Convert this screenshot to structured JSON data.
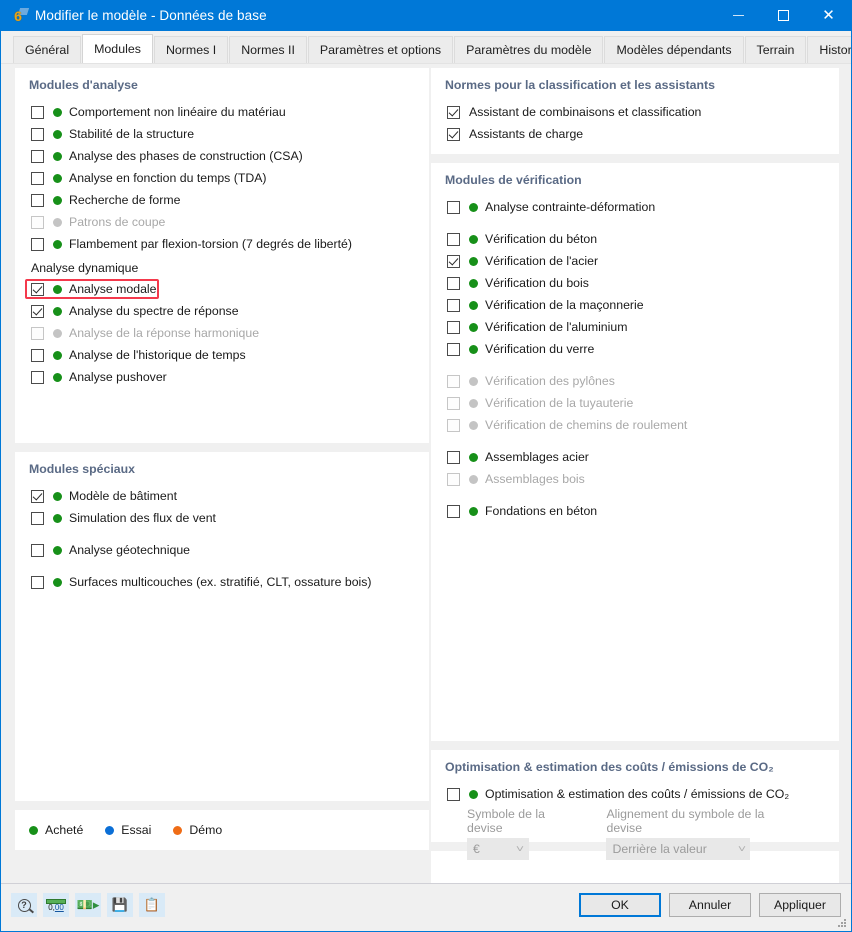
{
  "window": {
    "title": "Modifier le modèle - Données de base",
    "icon": "app-icon-rfem6",
    "minimize_label": "–",
    "maximize_label": "□",
    "close_label": "✕"
  },
  "tabs": [
    {
      "label": "Général",
      "active": false
    },
    {
      "label": "Modules",
      "active": true
    },
    {
      "label": "Normes I",
      "active": false
    },
    {
      "label": "Normes II",
      "active": false
    },
    {
      "label": "Paramètres et options",
      "active": false
    },
    {
      "label": "Paramètres du modèle",
      "active": false
    },
    {
      "label": "Modèles dépendants",
      "active": false
    },
    {
      "label": "Terrain",
      "active": false
    },
    {
      "label": "Historique",
      "active": false
    }
  ],
  "left": {
    "analysis_modules": {
      "title": "Modules d'analyse",
      "items": [
        {
          "label": "Comportement non linéaire du matériau",
          "checked": false,
          "enabled": true,
          "dot": "green"
        },
        {
          "label": "Stabilité de la structure",
          "checked": false,
          "enabled": true,
          "dot": "green"
        },
        {
          "label": "Analyse des phases de construction (CSA)",
          "checked": false,
          "enabled": true,
          "dot": "green"
        },
        {
          "label": "Analyse en fonction du temps (TDA)",
          "checked": false,
          "enabled": true,
          "dot": "green"
        },
        {
          "label": "Recherche de forme",
          "checked": false,
          "enabled": true,
          "dot": "green"
        },
        {
          "label": "Patrons de coupe",
          "checked": false,
          "enabled": false,
          "dot": "grey"
        },
        {
          "label": "Flambement par flexion-torsion (7 degrés de liberté)",
          "checked": false,
          "enabled": true,
          "dot": "green"
        }
      ],
      "dynamic_subtitle": "Analyse dynamique",
      "dynamic_items": [
        {
          "label": "Analyse modale",
          "checked": true,
          "enabled": true,
          "dot": "green",
          "highlighted": true
        },
        {
          "label": "Analyse du spectre de réponse",
          "checked": true,
          "enabled": true,
          "dot": "green"
        },
        {
          "label": "Analyse de la réponse harmonique",
          "checked": false,
          "enabled": false,
          "dot": "grey"
        },
        {
          "label": "Analyse de l'historique de temps",
          "checked": false,
          "enabled": true,
          "dot": "green"
        },
        {
          "label": "Analyse pushover",
          "checked": false,
          "enabled": true,
          "dot": "green"
        }
      ]
    },
    "special_modules": {
      "title": "Modules spéciaux",
      "items": [
        {
          "label": "Modèle de bâtiment",
          "checked": true,
          "enabled": true,
          "dot": "green",
          "gap": false
        },
        {
          "label": "Simulation des flux de vent",
          "checked": false,
          "enabled": true,
          "dot": "green",
          "gap": false
        },
        {
          "label": "Analyse géotechnique",
          "checked": false,
          "enabled": true,
          "dot": "green",
          "gap": true
        },
        {
          "label": "Surfaces multicouches (ex. stratifié, CLT, ossature bois)",
          "checked": false,
          "enabled": true,
          "dot": "green",
          "gap": true
        }
      ]
    },
    "legend": [
      {
        "label": "Acheté",
        "color": "green"
      },
      {
        "label": "Essai",
        "color": "blue"
      },
      {
        "label": "Démo",
        "color": "orange"
      }
    ]
  },
  "right": {
    "classification_standards": {
      "title": "Normes pour la classification et les assistants",
      "items": [
        {
          "label": "Assistant de combinaisons et classification",
          "checked": true,
          "enabled": true,
          "dot": "none"
        },
        {
          "label": "Assistants de charge",
          "checked": true,
          "enabled": true,
          "dot": "none"
        }
      ]
    },
    "design_modules": {
      "title": "Modules de vérification",
      "items": [
        {
          "label": "Analyse contrainte-déformation",
          "checked": false,
          "enabled": true,
          "dot": "green",
          "gap": false
        },
        {
          "label": "Vérification du béton",
          "checked": false,
          "enabled": true,
          "dot": "green",
          "gap": true
        },
        {
          "label": "Vérification de l'acier",
          "checked": true,
          "enabled": true,
          "dot": "green",
          "gap": false
        },
        {
          "label": "Vérification du bois",
          "checked": false,
          "enabled": true,
          "dot": "green",
          "gap": false
        },
        {
          "label": "Vérification de la maçonnerie",
          "checked": false,
          "enabled": true,
          "dot": "green",
          "gap": false
        },
        {
          "label": "Vérification de l'aluminium",
          "checked": false,
          "enabled": true,
          "dot": "green",
          "gap": false
        },
        {
          "label": "Vérification du verre",
          "checked": false,
          "enabled": true,
          "dot": "green",
          "gap": false
        },
        {
          "label": "Vérification des pylônes",
          "checked": false,
          "enabled": false,
          "dot": "grey",
          "gap": true
        },
        {
          "label": "Vérification de la tuyauterie",
          "checked": false,
          "enabled": false,
          "dot": "grey",
          "gap": false
        },
        {
          "label": "Vérification de chemins de roulement",
          "checked": false,
          "enabled": false,
          "dot": "grey",
          "gap": false
        },
        {
          "label": "Assemblages acier",
          "checked": false,
          "enabled": true,
          "dot": "green",
          "gap": true
        },
        {
          "label": "Assemblages bois",
          "checked": false,
          "enabled": false,
          "dot": "grey",
          "gap": false
        },
        {
          "label": "Fondations en béton",
          "checked": false,
          "enabled": true,
          "dot": "green",
          "gap": true
        }
      ]
    },
    "optimization": {
      "title": "Optimisation & estimation des coûts / émissions de CO₂",
      "checkbox": {
        "label": "Optimisation & estimation des coûts / émissions de CO₂",
        "checked": false,
        "enabled": true,
        "dot": "green"
      },
      "currency_symbol": {
        "label": "Symbole de la devise",
        "value": "€"
      },
      "currency_alignment": {
        "label": "Alignement du symbole de la devise",
        "value": "Derrière la valeur"
      }
    }
  },
  "footer": {
    "toolbar": [
      {
        "name": "help-icon",
        "tooltip": "Aide"
      },
      {
        "name": "units-icon",
        "tooltip": "Unités et décimales"
      },
      {
        "name": "costs-icon",
        "tooltip": "Coûts"
      },
      {
        "name": "save-as-icon",
        "tooltip": "Enregistrer sous"
      },
      {
        "name": "database-icon",
        "tooltip": "Importer depuis la base de données"
      }
    ],
    "buttons": [
      {
        "label": "OK",
        "primary": true
      },
      {
        "label": "Annuler",
        "primary": false
      },
      {
        "label": "Appliquer",
        "primary": false
      }
    ]
  },
  "colors": {
    "accent": "#0078d7",
    "purchased": "#179019",
    "trial": "#0b6fd6",
    "demo": "#ef6c16",
    "disabled": "#c4c4c4",
    "highlight": "#f4394c",
    "group_title": "#5a6a85"
  }
}
